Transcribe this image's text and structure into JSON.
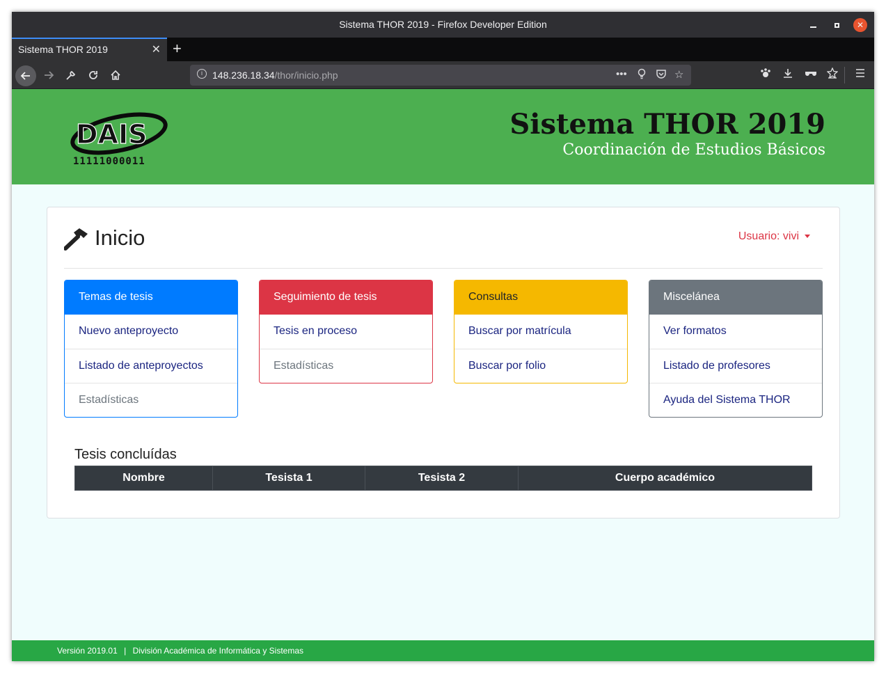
{
  "window": {
    "title": "Sistema THOR 2019 - Firefox Developer Edition",
    "min": "",
    "max": "",
    "close": "✕"
  },
  "tab": {
    "label": "Sistema THOR 2019",
    "close": "✕",
    "new": "+"
  },
  "nav": {
    "url_host": "148.236.18.34",
    "url_path": "/thor/inicio.php",
    "url_icons": [
      "more-dots-icon",
      "lightbulb-icon",
      "pocket-icon",
      "star-icon"
    ],
    "toolbar_icons": [
      "paw-icon",
      "download-icon",
      "mask-icon",
      "star-list-icon",
      "menu-icon"
    ]
  },
  "header": {
    "logo_text": "DAIS",
    "logo_binary": "11111000011",
    "title": "Sistema THOR 2019",
    "subtitle": "Coordinación de Estudios Básicos"
  },
  "main": {
    "page_title": "Inicio",
    "user_label": "Usuario: vivi",
    "panels": [
      {
        "title": "Temas de tesis",
        "color": "#007bff",
        "items": [
          "Nuevo anteproyecto",
          "Listado de anteproyectos",
          "Estadísticas"
        ]
      },
      {
        "title": "Seguimiento de tesis",
        "color": "#dc3545",
        "items": [
          "Tesis en proceso",
          "Estadísticas"
        ]
      },
      {
        "title": "Consultas",
        "color": "#f5b800",
        "items": [
          "Buscar por matrícula",
          "Buscar por folio"
        ]
      },
      {
        "title": "Miscelánea",
        "color": "#6c757d",
        "items": [
          "Ver formatos",
          "Listado de profesores",
          "Ayuda del Sistema THOR"
        ]
      }
    ],
    "table_title": "Tesis concluídas",
    "table_headers": [
      "Nombre",
      "Tesista 1",
      "Tesista 2",
      "Cuerpo académico"
    ]
  },
  "footer": {
    "version": "Versión 2019.01",
    "separator": "|",
    "division": "División Académica de Informática y Sistemas"
  },
  "colors": {
    "header_green": "#4caf50",
    "footer_green": "#28a745",
    "page_bg": "#f0fdfd"
  }
}
